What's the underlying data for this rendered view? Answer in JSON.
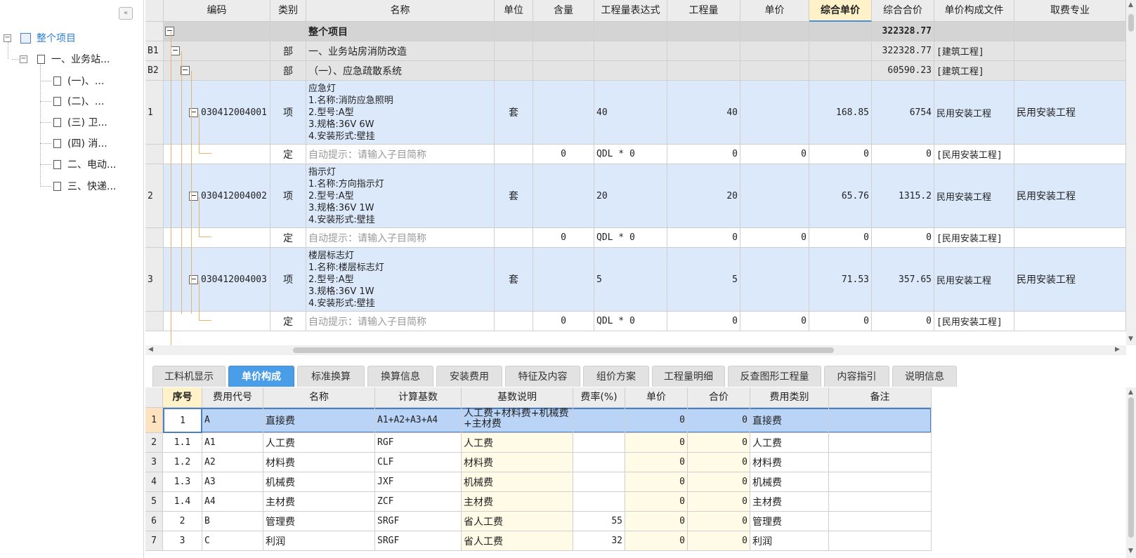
{
  "tree": {
    "collapse_icon": "«",
    "items": [
      {
        "label": "整个项目",
        "box": "−"
      },
      {
        "label": "一、业务站...",
        "box": "−"
      },
      {
        "label": "(一)、..."
      },
      {
        "label": "(二)、..."
      },
      {
        "label": "(三) 卫..."
      },
      {
        "label": "(四) 消..."
      },
      {
        "label": "二、电动..."
      },
      {
        "label": "三、快递..."
      }
    ]
  },
  "grid": {
    "headers": [
      "编码",
      "类别",
      "名称",
      "单位",
      "含量",
      "工程量表达式",
      "工程量",
      "单价",
      "综合单价",
      "综合合价",
      "单价构成文件",
      "取费专业"
    ],
    "rows": [
      {
        "seq": "",
        "code": "",
        "type": "",
        "name": "整个项目",
        "unit": "",
        "content": "",
        "expr": "",
        "qty": "",
        "price": "",
        "uprice": "",
        "total": "322328.77",
        "file": "",
        "spec": ""
      },
      {
        "seq": "B1",
        "code": "",
        "type": "部",
        "name": "一、业务站房消防改造",
        "unit": "",
        "content": "",
        "expr": "",
        "qty": "",
        "price": "",
        "uprice": "",
        "total": "322328.77",
        "file": "[建筑工程]",
        "spec": ""
      },
      {
        "seq": "B2",
        "code": "",
        "type": "部",
        "name": "（一）、应急疏散系统",
        "unit": "",
        "content": "",
        "expr": "",
        "qty": "",
        "price": "",
        "uprice": "",
        "total": "60590.23",
        "file": "[建筑工程]",
        "spec": ""
      },
      {
        "seq": "1",
        "code": "030412004001",
        "type": "项",
        "name": [
          "应急灯",
          "1.名称:消防应急照明",
          "2.型号:A型",
          "3.规格:36V 6W",
          "4.安装形式:壁挂"
        ],
        "unit": "套",
        "content": "",
        "expr": "40",
        "qty": "40",
        "price": "",
        "uprice": "168.85",
        "total": "6754",
        "file": "民用安装工程",
        "spec": "民用安装工程"
      },
      {
        "seq": "",
        "code": "",
        "type": "定",
        "name": "自动提示：请输入子目简称",
        "unit": "",
        "content": "0",
        "expr": "QDL * 0",
        "qty": "0",
        "price": "0",
        "uprice": "0",
        "total": "0",
        "file": "[民用安装工程]",
        "spec": ""
      },
      {
        "seq": "2",
        "code": "030412004002",
        "type": "项",
        "name": [
          "指示灯",
          "1.名称:方向指示灯",
          "2.型号:A型",
          "3.规格:36V 1W",
          "4.安装形式:壁挂"
        ],
        "unit": "套",
        "content": "",
        "expr": "20",
        "qty": "20",
        "price": "",
        "uprice": "65.76",
        "total": "1315.2",
        "file": "民用安装工程",
        "spec": "民用安装工程"
      },
      {
        "seq": "",
        "code": "",
        "type": "定",
        "name": "自动提示：请输入子目简称",
        "unit": "",
        "content": "0",
        "expr": "QDL * 0",
        "qty": "0",
        "price": "0",
        "uprice": "0",
        "total": "0",
        "file": "[民用安装工程]",
        "spec": ""
      },
      {
        "seq": "3",
        "code": "030412004003",
        "type": "项",
        "name": [
          "楼层标志灯",
          "1.名称:楼层标志灯",
          "2.型号:A型",
          "3.规格:36V 1W",
          "4.安装形式:壁挂"
        ],
        "unit": "套",
        "content": "",
        "expr": "5",
        "qty": "5",
        "price": "",
        "uprice": "71.53",
        "total": "357.65",
        "file": "民用安装工程",
        "spec": "民用安装工程"
      },
      {
        "seq": "",
        "code": "",
        "type": "定",
        "name": "自动提示：请输入子目简称",
        "unit": "",
        "content": "0",
        "expr": "QDL * 0",
        "qty": "0",
        "price": "0",
        "uprice": "0",
        "total": "0",
        "file": "[民用安装工程]",
        "spec": ""
      }
    ]
  },
  "tabs": [
    "工料机显示",
    "单价构成",
    "标准换算",
    "换算信息",
    "安装费用",
    "特征及内容",
    "组价方案",
    "工程量明细",
    "反查图形工程量",
    "内容指引",
    "说明信息"
  ],
  "bottom": {
    "headers": [
      "序号",
      "费用代号",
      "名称",
      "计算基数",
      "基数说明",
      "费率(%)",
      "单价",
      "合价",
      "费用类别",
      "备注"
    ],
    "rows": [
      {
        "n": "1",
        "seq": "1",
        "code": "A",
        "name": "直接费",
        "base": "A1+A2+A3+A4",
        "desc": "人工费+材料费+机械费+主材费",
        "rate": "",
        "price": "0",
        "total": "0",
        "cat": "直接费",
        "note": ""
      },
      {
        "n": "2",
        "seq": "1.1",
        "code": "A1",
        "name": "人工费",
        "base": "RGF",
        "desc": "人工费",
        "rate": "",
        "price": "0",
        "total": "0",
        "cat": "人工费",
        "note": ""
      },
      {
        "n": "3",
        "seq": "1.2",
        "code": "A2",
        "name": "材料费",
        "base": "CLF",
        "desc": "材料费",
        "rate": "",
        "price": "0",
        "total": "0",
        "cat": "材料费",
        "note": ""
      },
      {
        "n": "4",
        "seq": "1.3",
        "code": "A3",
        "name": "机械费",
        "base": "JXF",
        "desc": "机械费",
        "rate": "",
        "price": "0",
        "total": "0",
        "cat": "机械费",
        "note": ""
      },
      {
        "n": "5",
        "seq": "1.4",
        "code": "A4",
        "name": "主材费",
        "base": "ZCF",
        "desc": "主材费",
        "rate": "",
        "price": "0",
        "total": "0",
        "cat": "主材费",
        "note": ""
      },
      {
        "n": "6",
        "seq": "2",
        "code": "B",
        "name": "管理费",
        "base": "SRGF",
        "desc": "省人工费",
        "rate": "55",
        "price": "0",
        "total": "0",
        "cat": "管理费",
        "note": ""
      },
      {
        "n": "7",
        "seq": "3",
        "code": "C",
        "name": "利润",
        "base": "SRGF",
        "desc": "省人工费",
        "rate": "32",
        "price": "0",
        "total": "0",
        "cat": "利润",
        "note": ""
      }
    ]
  }
}
